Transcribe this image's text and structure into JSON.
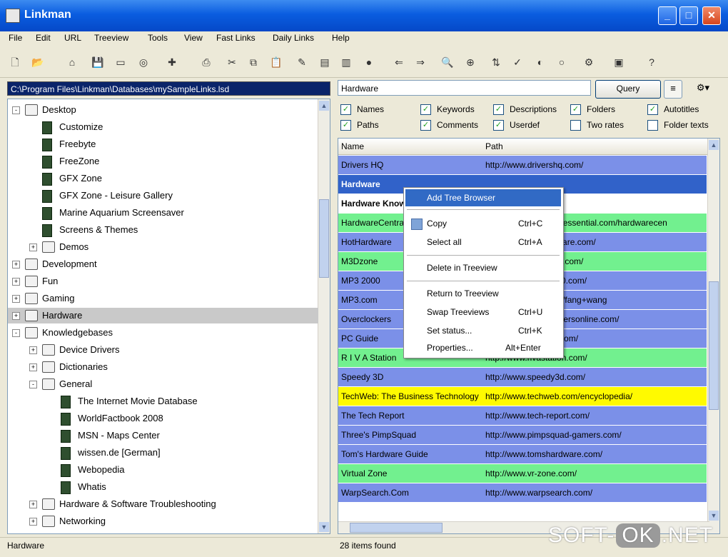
{
  "window": {
    "title": "Linkman"
  },
  "menu": [
    "File",
    "Edit",
    "URL",
    "Treeview",
    "Tools",
    "View",
    "Fast Links",
    "Daily Links",
    "Help"
  ],
  "path": "C:\\Program Files\\Linkman\\Databases\\mySampleLinks.lsd",
  "tree": [
    {
      "label": "Desktop",
      "depth": 0,
      "exp": "-",
      "kind": "folder"
    },
    {
      "label": "Customize",
      "depth": 1,
      "exp": "",
      "kind": "doc"
    },
    {
      "label": "Freebyte",
      "depth": 1,
      "exp": "",
      "kind": "doc"
    },
    {
      "label": "FreeZone",
      "depth": 1,
      "exp": "",
      "kind": "doc"
    },
    {
      "label": "GFX Zone",
      "depth": 1,
      "exp": "",
      "kind": "doc"
    },
    {
      "label": "GFX Zone - Leisure Gallery",
      "depth": 1,
      "exp": "",
      "kind": "doc"
    },
    {
      "label": "Marine Aquarium Screensaver",
      "depth": 1,
      "exp": "",
      "kind": "doc"
    },
    {
      "label": "Screens & Themes",
      "depth": 1,
      "exp": "",
      "kind": "doc"
    },
    {
      "label": "Demos",
      "depth": 1,
      "exp": "+",
      "kind": "folder"
    },
    {
      "label": "Development",
      "depth": 0,
      "exp": "+",
      "kind": "folder"
    },
    {
      "label": "Fun",
      "depth": 0,
      "exp": "+",
      "kind": "folder"
    },
    {
      "label": "Gaming",
      "depth": 0,
      "exp": "+",
      "kind": "folder"
    },
    {
      "label": "Hardware",
      "depth": 0,
      "exp": "+",
      "kind": "folder",
      "selected": true
    },
    {
      "label": "Knowledgebases",
      "depth": 0,
      "exp": "-",
      "kind": "folder"
    },
    {
      "label": "Device Drivers",
      "depth": 1,
      "exp": "+",
      "kind": "folder"
    },
    {
      "label": "Dictionaries",
      "depth": 1,
      "exp": "+",
      "kind": "folder"
    },
    {
      "label": "General",
      "depth": 1,
      "exp": "-",
      "kind": "folder"
    },
    {
      "label": "The Internet Movie Database",
      "depth": 2,
      "exp": "",
      "kind": "doc"
    },
    {
      "label": "WorldFactbook 2008",
      "depth": 2,
      "exp": "",
      "kind": "doc"
    },
    {
      "label": "MSN - Maps Center",
      "depth": 2,
      "exp": "",
      "kind": "doc"
    },
    {
      "label": "wissen.de [German]",
      "depth": 2,
      "exp": "",
      "kind": "doc"
    },
    {
      "label": "Webopedia",
      "depth": 2,
      "exp": "",
      "kind": "doc"
    },
    {
      "label": "Whatis",
      "depth": 2,
      "exp": "",
      "kind": "doc"
    },
    {
      "label": "Hardware & Software Troubleshooting",
      "depth": 1,
      "exp": "+",
      "kind": "folder"
    },
    {
      "label": "Networking",
      "depth": 1,
      "exp": "+",
      "kind": "folder"
    }
  ],
  "search": {
    "value": "Hardware",
    "query_label": "Query"
  },
  "filters": [
    {
      "label": "Names",
      "checked": true
    },
    {
      "label": "Keywords",
      "checked": true
    },
    {
      "label": "Descriptions",
      "checked": true
    },
    {
      "label": "Folders",
      "checked": true
    },
    {
      "label": "Autotitles",
      "checked": true
    },
    {
      "label": "Paths",
      "checked": true
    },
    {
      "label": "Comments",
      "checked": true
    },
    {
      "label": "Userdef",
      "checked": true
    },
    {
      "label": "Two rates",
      "checked": false
    },
    {
      "label": "Folder texts",
      "checked": false
    }
  ],
  "columns": [
    "Name",
    "Path"
  ],
  "rows": [
    {
      "name": "Drivers HQ",
      "path": "http://www.drivershq.com/",
      "color": "blue"
    },
    {
      "name": "Hardware",
      "path": "",
      "color": "sel"
    },
    {
      "name": "Hardware Knowledgebases",
      "path": "ases/",
      "color": "white"
    },
    {
      "name": "HardwareCentral",
      "path": "http://www.hardwareessential.com/hardwarecen",
      "color": "green"
    },
    {
      "name": "HotHardware",
      "path": "http://www.hothardware.com/",
      "color": "blue"
    },
    {
      "name": "M3Dzone",
      "path": "http://www.m3dzone.com/",
      "color": "green"
    },
    {
      "name": "MP3 2000",
      "path": "http://www.mp3-2000.com/",
      "color": "blue"
    },
    {
      "name": "MP3.com",
      "path": "http://www.mp3.com/fang+wang",
      "color": "blue"
    },
    {
      "name": "Overclockers",
      "path": "http://www.overclockersonline.com/",
      "color": "blue"
    },
    {
      "name": "PC Guide",
      "path": "http://www.pcguide.com/",
      "color": "blue"
    },
    {
      "name": "R I V A Station",
      "path": "http://www.rivastation.com/",
      "color": "green"
    },
    {
      "name": "Speedy 3D",
      "path": "http://www.speedy3d.com/",
      "color": "blue"
    },
    {
      "name": "TechWeb: The Business Technology",
      "path": "http://www.techweb.com/encyclopedia/",
      "color": "yellow"
    },
    {
      "name": "The Tech Report",
      "path": "http://www.tech-report.com/",
      "color": "blue"
    },
    {
      "name": "Three's PimpSquad",
      "path": "http://www.pimpsquad-gamers.com/",
      "color": "blue"
    },
    {
      "name": "Tom's Hardware Guide",
      "path": "http://www.tomshardware.com/",
      "color": "blue"
    },
    {
      "name": "Virtual Zone",
      "path": "http://www.vr-zone.com/",
      "color": "green"
    },
    {
      "name": "WarpSearch.Com",
      "path": "http://www.warpsearch.com/",
      "color": "blue"
    }
  ],
  "context_menu": [
    {
      "label": "Add Tree Browser",
      "key": "",
      "highlight": true
    },
    {
      "label": "Copy",
      "key": "Ctrl+C"
    },
    {
      "label": "Select all",
      "key": "Ctrl+A"
    },
    {
      "label": "Delete in Treeview",
      "key": ""
    },
    {
      "label": "Return to Treeview",
      "key": ""
    },
    {
      "label": "Swap Treeviews",
      "key": "Ctrl+U"
    },
    {
      "label": "Set status...",
      "key": "Ctrl+K"
    },
    {
      "label": "Properties...",
      "key": "Alt+Enter"
    }
  ],
  "status": {
    "left": "Hardware",
    "right": "28 items found"
  },
  "watermark": {
    "a": "SOFT-",
    "b": "OK",
    "c": ".NET"
  },
  "colors": {
    "blue": "#7b90e8",
    "green": "#72f08f",
    "yellow": "#fffa00",
    "selected": "#3162c9"
  }
}
